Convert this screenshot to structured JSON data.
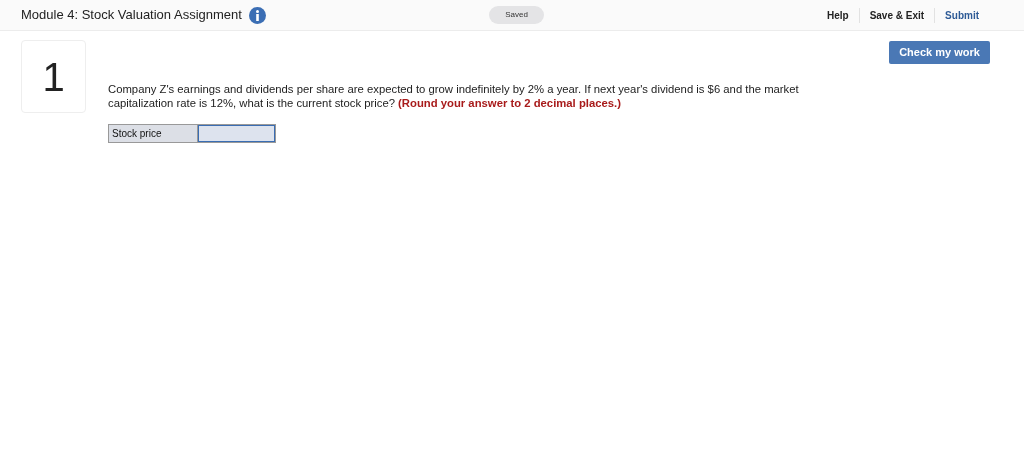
{
  "header": {
    "title": "Module 4: Stock Valuation Assignment",
    "save_status": "Saved",
    "links": [
      "Help",
      "Save & Exit",
      "Submit"
    ]
  },
  "check_button": "Check my work",
  "question": {
    "number": "1",
    "text": "Company Z's earnings and dividends per share are expected to grow indefinitely by 2% a year. If next year's dividend is $6 and the market capitalization rate is 12%, what is the current stock price? **(Round your answer to 2 decimal places.)**",
    "answer_row": {
      "label": "Stock price"
    }
  }
}
